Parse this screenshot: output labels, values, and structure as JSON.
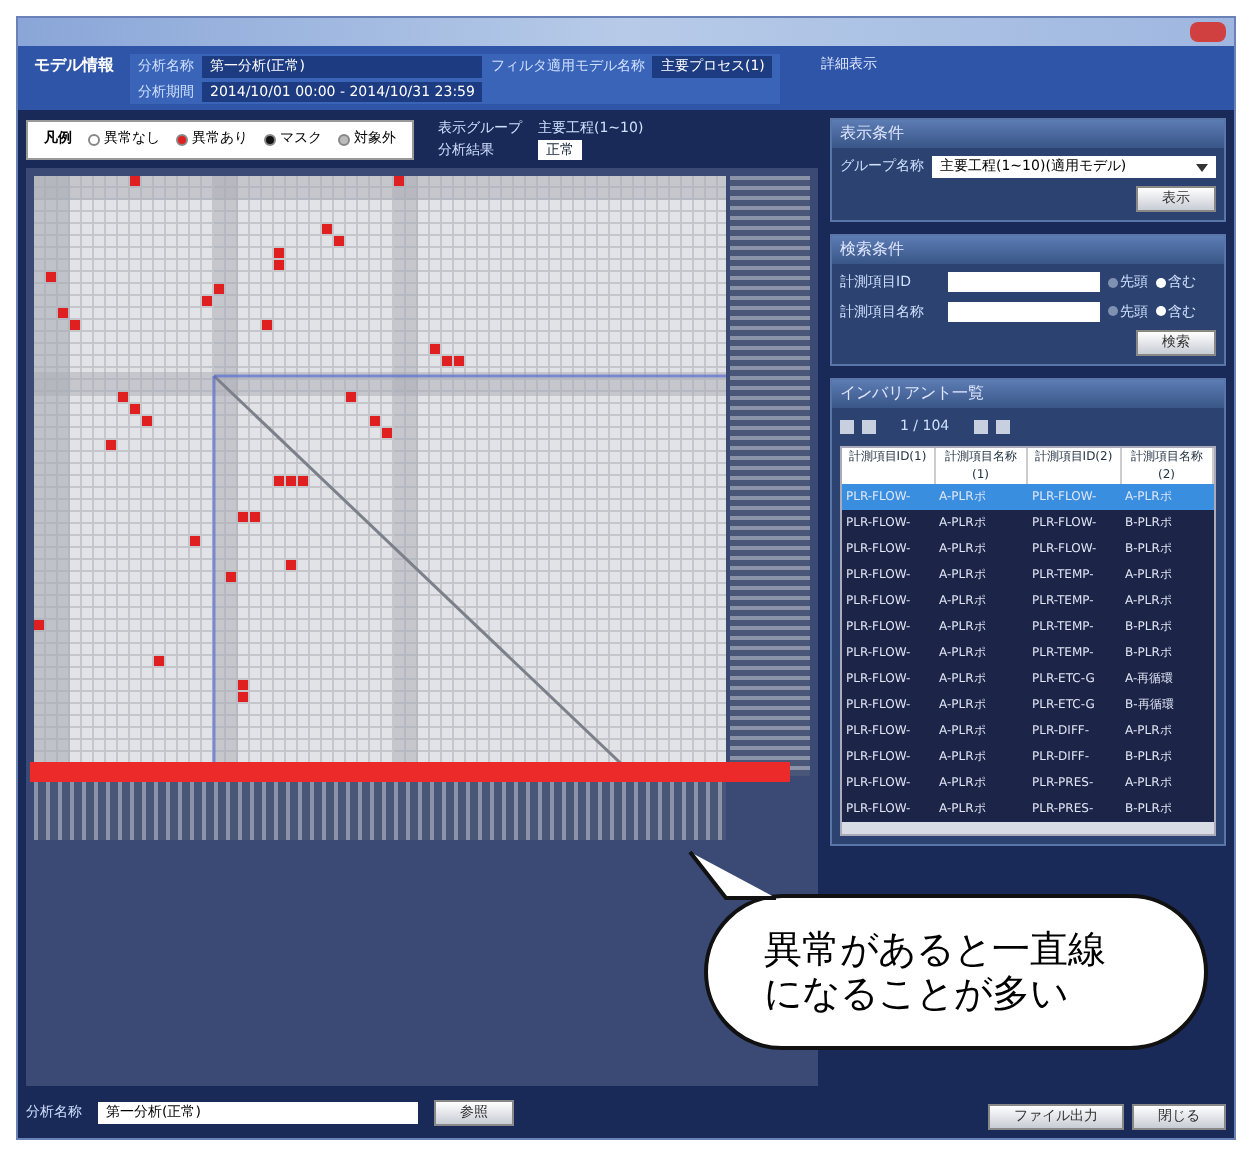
{
  "header": {
    "label": "モデル情報",
    "fields": [
      {
        "label": "分析名称",
        "value": "第一分析(正常)"
      },
      {
        "label": "フィルタ適用モデル名称",
        "value": "主要プロセス(1)"
      },
      {
        "label": "分析期間",
        "value": "2014/10/01 00:00 - 2014/10/31 23:59"
      }
    ],
    "detail_button": "詳細表示"
  },
  "legend": {
    "title": "凡例",
    "items": [
      {
        "label": "異常なし",
        "color": "#ffffff"
      },
      {
        "label": "異常あり",
        "color": "#e02020"
      },
      {
        "label": "マスク",
        "color": "#111111"
      },
      {
        "label": "対象外",
        "color": "#bbbbbb"
      }
    ]
  },
  "group_info": [
    {
      "label": "表示グループ",
      "value": "主要工程(1~10)"
    },
    {
      "label": "分析結果",
      "value": "正常"
    }
  ],
  "display_panel": {
    "title": "表示条件",
    "group_label": "グループ名称",
    "group_value": "主要工程(1~10)(適用モデル)",
    "button": "表示"
  },
  "search_panel": {
    "title": "検索条件",
    "rows": [
      {
        "label": "計測項目ID",
        "options": [
          {
            "label": "先頭",
            "selected": false
          },
          {
            "label": "含む",
            "selected": true
          }
        ]
      },
      {
        "label": "計測項目名称",
        "options": [
          {
            "label": "先頭",
            "selected": false
          },
          {
            "label": "含む",
            "selected": true
          }
        ]
      }
    ],
    "button": "検索"
  },
  "list_panel": {
    "title": "インバリアント一覧",
    "page": "1 / 104",
    "columns": [
      "計測項目ID(1)",
      "計測項目名称(1)",
      "計測項目ID(2)",
      "計測項目名称(2)"
    ],
    "rows": [
      {
        "selected": true,
        "cells": [
          "PLR-FLOW-",
          "A-PLRポ",
          "PLR-FLOW-",
          "A-PLRポ"
        ]
      },
      {
        "selected": false,
        "cells": [
          "PLR-FLOW-",
          "A-PLRポ",
          "PLR-FLOW-",
          "B-PLRポ"
        ]
      },
      {
        "selected": false,
        "cells": [
          "PLR-FLOW-",
          "A-PLRポ",
          "PLR-FLOW-",
          "B-PLRポ"
        ]
      },
      {
        "selected": false,
        "cells": [
          "PLR-FLOW-",
          "A-PLRポ",
          "PLR-TEMP-",
          "A-PLRポ"
        ]
      },
      {
        "selected": false,
        "cells": [
          "PLR-FLOW-",
          "A-PLRポ",
          "PLR-TEMP-",
          "A-PLRポ"
        ]
      },
      {
        "selected": false,
        "cells": [
          "PLR-FLOW-",
          "A-PLRポ",
          "PLR-TEMP-",
          "B-PLRポ"
        ]
      },
      {
        "selected": false,
        "cells": [
          "PLR-FLOW-",
          "A-PLRポ",
          "PLR-TEMP-",
          "B-PLRポ"
        ]
      },
      {
        "selected": false,
        "cells": [
          "PLR-FLOW-",
          "A-PLRポ",
          "PLR-ETC-G",
          "A-再循環"
        ]
      },
      {
        "selected": false,
        "cells": [
          "PLR-FLOW-",
          "A-PLRポ",
          "PLR-ETC-G",
          "B-再循環"
        ]
      },
      {
        "selected": false,
        "cells": [
          "PLR-FLOW-",
          "A-PLRポ",
          "PLR-DIFF-",
          "A-PLRポ"
        ]
      },
      {
        "selected": false,
        "cells": [
          "PLR-FLOW-",
          "A-PLRポ",
          "PLR-DIFF-",
          "B-PLRポ"
        ]
      },
      {
        "selected": false,
        "cells": [
          "PLR-FLOW-",
          "A-PLRポ",
          "PLR-PRES-",
          "A-PLRポ"
        ]
      },
      {
        "selected": false,
        "cells": [
          "PLR-FLOW-",
          "A-PLRポ",
          "PLR-PRES-",
          "B-PLRポ"
        ]
      }
    ]
  },
  "bottom": {
    "label": "分析名称",
    "value": "第一分析(正常)",
    "button": "参照"
  },
  "buttons": [
    "ファイル出力",
    "閉じる"
  ],
  "callout": {
    "lines": [
      "異常があると一直線",
      "になることが多い"
    ]
  }
}
